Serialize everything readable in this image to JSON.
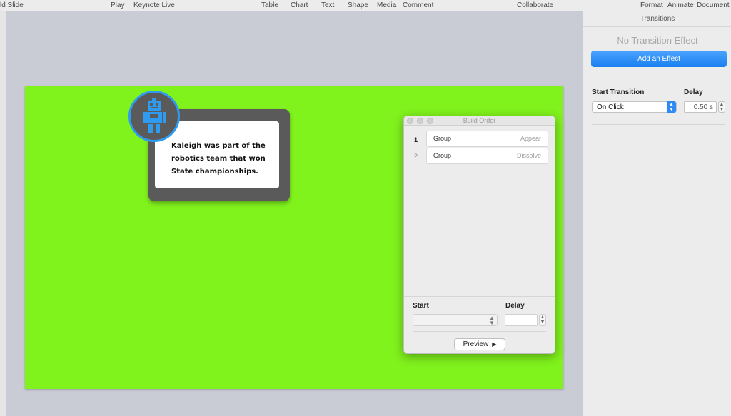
{
  "toolbar": {
    "add_slide": "ld Slide",
    "play": "Play",
    "keynote_live": "Keynote Live",
    "table": "Table",
    "chart": "Chart",
    "text": "Text",
    "shape": "Shape",
    "media": "Media",
    "comment": "Comment",
    "collaborate": "Collaborate",
    "format": "Format",
    "animate": "Animate",
    "document": "Document"
  },
  "slide": {
    "background_color": "#80f21c",
    "card_text_line1": "Kaleigh was part of the",
    "card_text_line2": "robotics team that won",
    "card_text_line3": "State championships.",
    "robot_icon": "robot-icon",
    "accent_color": "#2f9bf0"
  },
  "build_order": {
    "title": "Build Order",
    "items": [
      {
        "num": "1",
        "name": "Group",
        "effect": "Appear"
      },
      {
        "num": "2",
        "name": "Group",
        "effect": "Dissolve"
      }
    ],
    "start_label": "Start",
    "start_value": "",
    "delay_label": "Delay",
    "delay_value": "",
    "preview_label": "Preview"
  },
  "inspector": {
    "tab_title": "Transitions",
    "no_effect_text": "No Transition Effect",
    "add_effect_label": "Add an Effect",
    "start_transition_label": "Start Transition",
    "start_transition_value": "On Click",
    "delay_label": "Delay",
    "delay_value": "0.50 s",
    "accent_color": "#1b7ff0"
  }
}
